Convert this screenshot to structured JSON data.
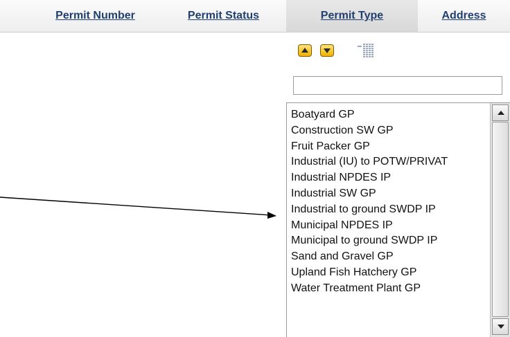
{
  "columns": [
    {
      "label": "Permit Number"
    },
    {
      "label": "Permit Status"
    },
    {
      "label": "Permit Type"
    },
    {
      "label": "Address"
    }
  ],
  "filter": {
    "sort_ascending_icon": "sort-ascending-icon",
    "sort_descending_icon": "sort-descending-icon",
    "select_all_icon": "select-all-icon",
    "search_value": "",
    "options": [
      "Boatyard GP",
      "Construction SW GP",
      "Fruit Packer GP",
      "Industrial (IU) to POTW/PRIVAT",
      "Industrial NPDES IP",
      "Industrial SW GP",
      "Industrial to ground SWDP IP",
      "Municipal NPDES IP",
      "Municipal to ground SWDP IP",
      "Sand and Gravel GP",
      "Upland Fish Hatchery GP",
      "Water Treatment Plant GP"
    ]
  },
  "colors": {
    "header_link": "#1f3f6e",
    "sort_button": "#f0b400",
    "annotation_arrow": "#000000"
  }
}
